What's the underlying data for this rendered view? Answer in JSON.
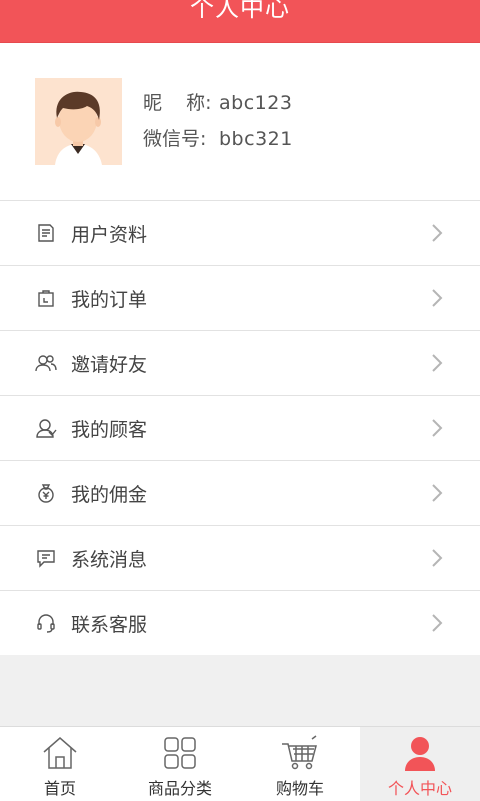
{
  "header": {
    "title": "个人中心"
  },
  "profile": {
    "nickname_label": "昵    称:",
    "nickname_value": "abc123",
    "wechat_label": "微信号:",
    "wechat_value": "bbc321"
  },
  "menu": [
    {
      "label": "用户资料",
      "icon": "document-icon"
    },
    {
      "label": "我的订单",
      "icon": "order-bag-icon"
    },
    {
      "label": "邀请好友",
      "icon": "users-icon"
    },
    {
      "label": "我的顾客",
      "icon": "customer-icon"
    },
    {
      "label": "我的佣金",
      "icon": "money-bag-icon"
    },
    {
      "label": "系统消息",
      "icon": "message-icon"
    },
    {
      "label": "联系客服",
      "icon": "headset-icon"
    }
  ],
  "tabbar": [
    {
      "label": "首页",
      "icon": "home-icon"
    },
    {
      "label": "商品分类",
      "icon": "grid-icon"
    },
    {
      "label": "购物车",
      "icon": "cart-icon"
    },
    {
      "label": "个人中心",
      "icon": "person-icon",
      "active": true
    }
  ],
  "colors": {
    "accent": "#f25458",
    "background": "#f0f0f0"
  }
}
